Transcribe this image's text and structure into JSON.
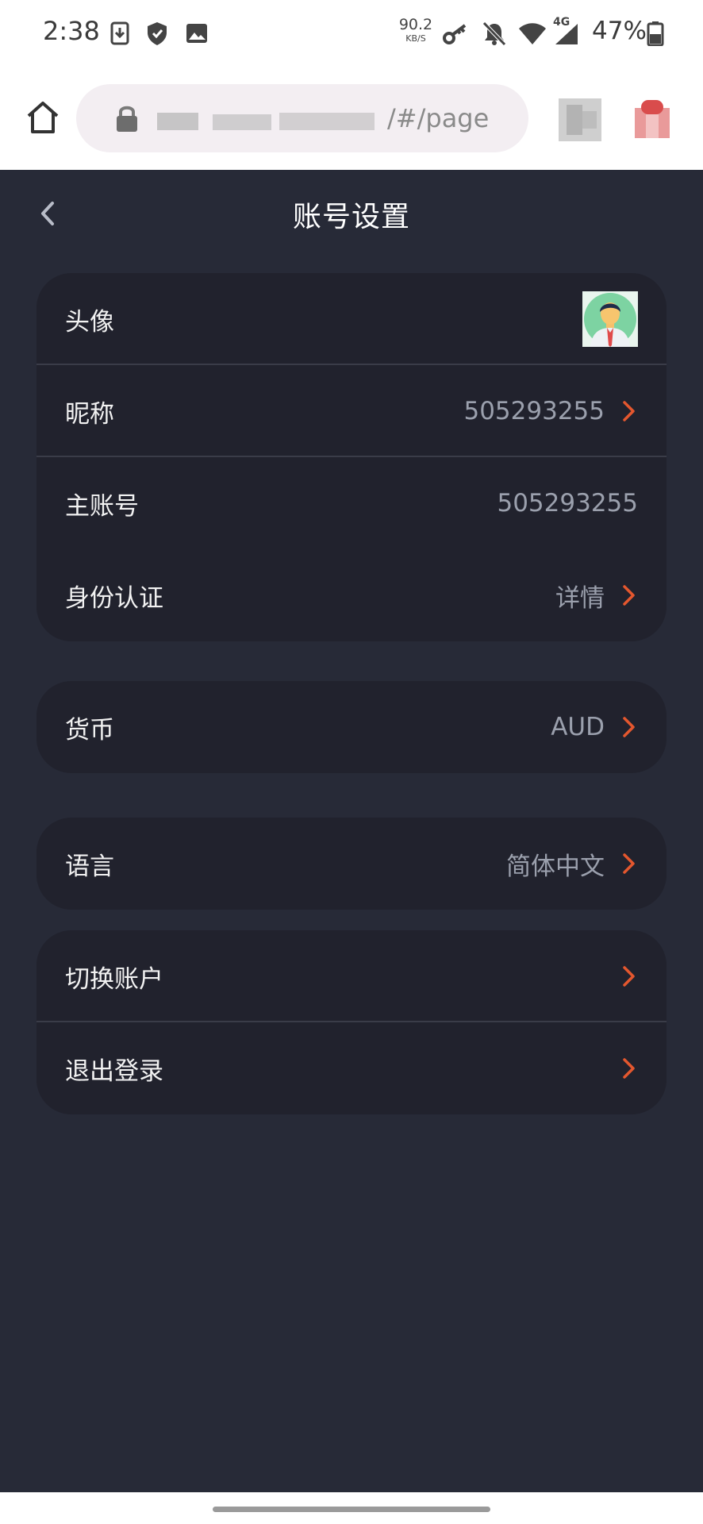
{
  "status_bar": {
    "time": "2:38",
    "net_speed_value": "90.2",
    "net_speed_unit": "KB/S",
    "network_type": "4G",
    "battery": "47%",
    "icons": [
      "download-icon",
      "shield-icon",
      "image-icon",
      "key-icon",
      "bell-off-icon",
      "wifi-icon",
      "signal-icon",
      "battery-icon"
    ]
  },
  "browser": {
    "url_visible_fragment": "/#/page",
    "icons": [
      "home-icon",
      "lock-icon",
      "tabs-icon",
      "extension-icon"
    ]
  },
  "header": {
    "title": "账号设置",
    "back_icon": "chevron-left-icon"
  },
  "colors": {
    "page_bg": "#272a37",
    "card_bg": "#21222d",
    "accent": "#e4572e",
    "value_text": "#9ba0ad"
  },
  "profile_card": {
    "avatar_label": "头像",
    "nickname_label": "昵称",
    "nickname_value": "505293255",
    "main_account_label": "主账号",
    "main_account_value": "505293255",
    "identity_label": "身份认证",
    "identity_value": "详情"
  },
  "currency_card": {
    "label": "货币",
    "value": "AUD"
  },
  "language_card": {
    "label": "语言",
    "value": "简体中文"
  },
  "account_card": {
    "switch_label": "切换账户",
    "logout_label": "退出登录"
  }
}
